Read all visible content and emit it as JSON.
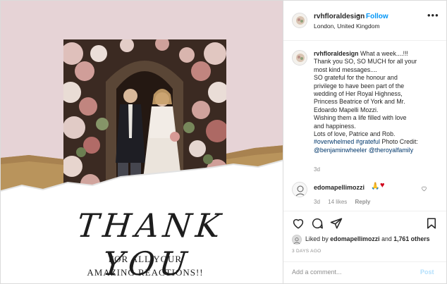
{
  "image": {
    "headline": "THANK YOU",
    "subline_1": "FOR ALL YOUR",
    "subline_2": "AMAZING REACTIONS!!"
  },
  "header": {
    "username": "rvhfloraldesign",
    "separator": "•",
    "follow_label": "Follow",
    "location": "London, United Kingdom",
    "more_icon": "more-horizontal-icon"
  },
  "caption": {
    "username": "rvhfloraldesign",
    "lines": [
      "What a week....!!!",
      "Thank you SO, SO MUCH for all your",
      "most kind messages....",
      "SO grateful for the honour and",
      "privilege to have been part of the",
      "wedding of Her Royal Highness,",
      "Princess Beatrice of York and Mr.",
      "Edoardo Mapelli Mozzi.",
      "Wishing them a life filled with love",
      "and happiness.",
      "Lots of love, Patrice and Rob."
    ],
    "tag_1": "#overwhelmed",
    "tag_2": "#grateful",
    "photo_credit": "Photo Credit:",
    "mention_1": "@benjaminwheeler",
    "mention_2": "@theroyalfamily",
    "time": "3d"
  },
  "comment": {
    "username": "edomapellimozzi",
    "emoji_1": "🙏",
    "emoji_2": "♥",
    "time": "3d",
    "likes": "14 likes",
    "reply_label": "Reply"
  },
  "actions": {
    "icons": [
      "heart-icon",
      "comment-icon",
      "share-icon",
      "bookmark-icon"
    ],
    "liked_by_prefix": "Liked by",
    "liked_by_user": "edomapellimozzi",
    "liked_by_and": "and",
    "liked_by_count": "1,761 others",
    "post_time": "3 DAYS AGO"
  },
  "add_comment": {
    "placeholder": "Add a comment...",
    "post_label": "Post"
  },
  "colors": {
    "accent": "#0095f6",
    "hashtag": "#00376b",
    "pink_background": "#e6d3d6"
  }
}
